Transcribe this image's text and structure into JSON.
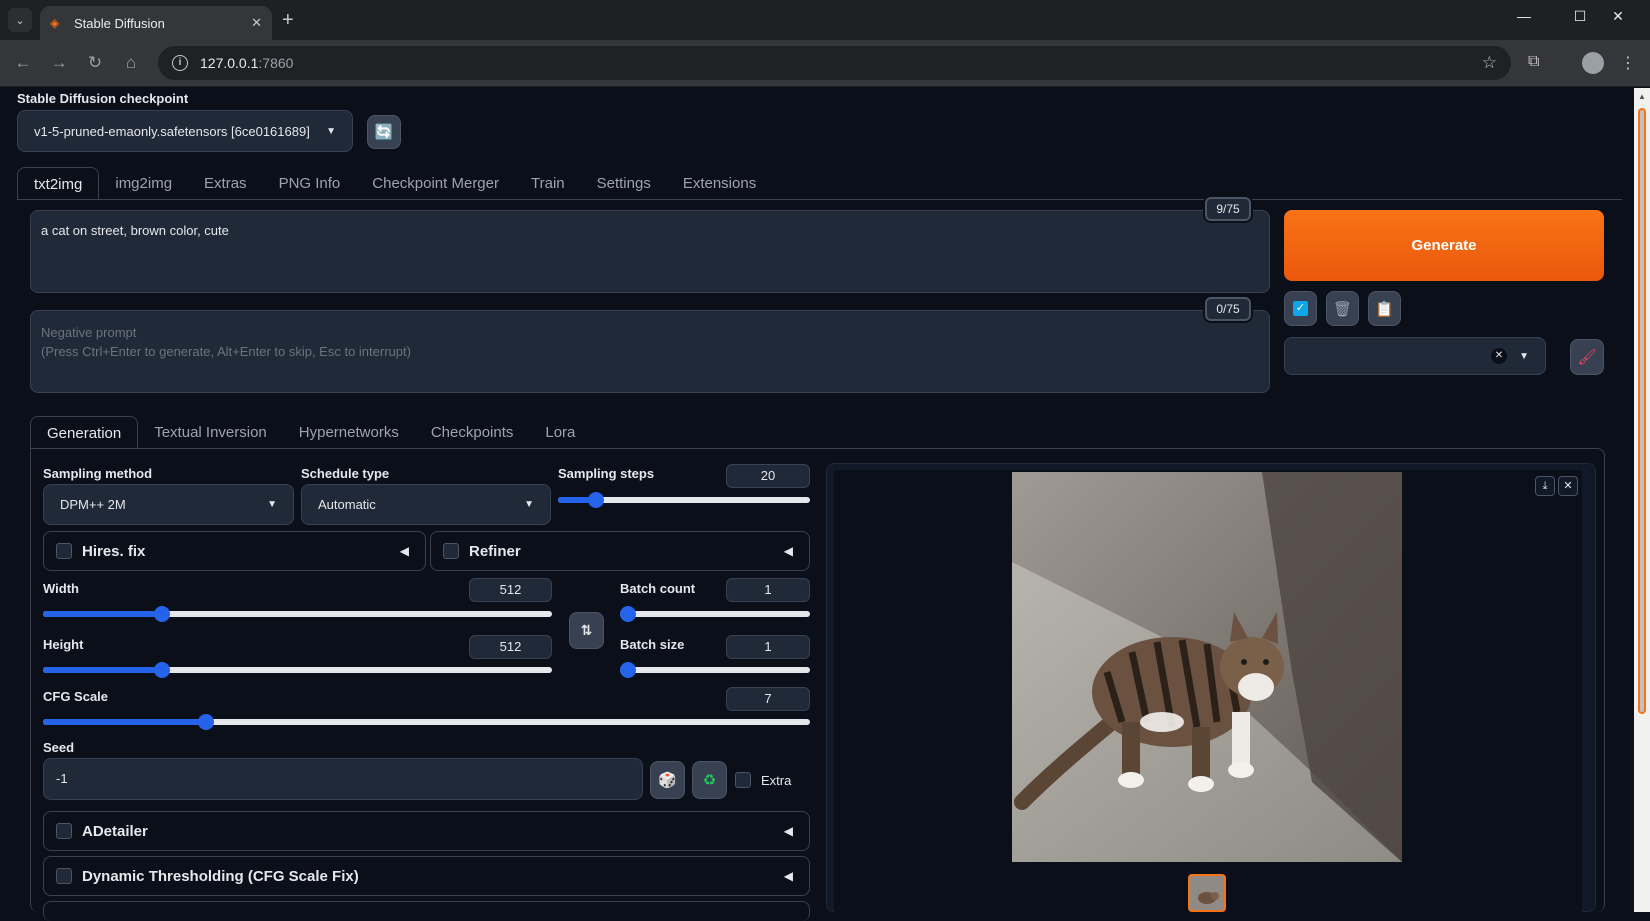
{
  "browser": {
    "tab_title": "Stable Diffusion",
    "url_host": "127.0.0.1",
    "url_port": ":7860"
  },
  "checkpoint": {
    "label": "Stable Diffusion checkpoint",
    "value": "v1-5-pruned-emaonly.safetensors [6ce0161689]"
  },
  "main_tabs": [
    "txt2img",
    "img2img",
    "Extras",
    "PNG Info",
    "Checkpoint Merger",
    "Train",
    "Settings",
    "Extensions"
  ],
  "prompt": {
    "value": "a cat on street, brown color, cute",
    "counter": "9/75"
  },
  "negative_prompt": {
    "placeholder_line1": "Negative prompt",
    "placeholder_line2": "(Press Ctrl+Enter to generate, Alt+Enter to skip, Esc to interrupt)",
    "counter": "0/75"
  },
  "generate_label": "Generate",
  "sub_tabs": [
    "Generation",
    "Textual Inversion",
    "Hypernetworks",
    "Checkpoints",
    "Lora"
  ],
  "sampling_method": {
    "label": "Sampling method",
    "value": "DPM++ 2M"
  },
  "schedule_type": {
    "label": "Schedule type",
    "value": "Automatic"
  },
  "sampling_steps": {
    "label": "Sampling steps",
    "value": "20"
  },
  "hires_fix": {
    "label": "Hires. fix"
  },
  "refiner": {
    "label": "Refiner"
  },
  "width": {
    "label": "Width",
    "value": "512"
  },
  "height": {
    "label": "Height",
    "value": "512"
  },
  "batch_count": {
    "label": "Batch count",
    "value": "1"
  },
  "batch_size": {
    "label": "Batch size",
    "value": "1"
  },
  "cfg_scale": {
    "label": "CFG Scale",
    "value": "7"
  },
  "seed": {
    "label": "Seed",
    "value": "-1",
    "extra_label": "Extra"
  },
  "adetailer": {
    "label": "ADetailer"
  },
  "dynamic_thresholding": {
    "label": "Dynamic Thresholding (CFG Scale Fix)"
  },
  "colors": {
    "accent": "#f97316",
    "slider": "#2563eb",
    "bg": "#0b0f19"
  }
}
